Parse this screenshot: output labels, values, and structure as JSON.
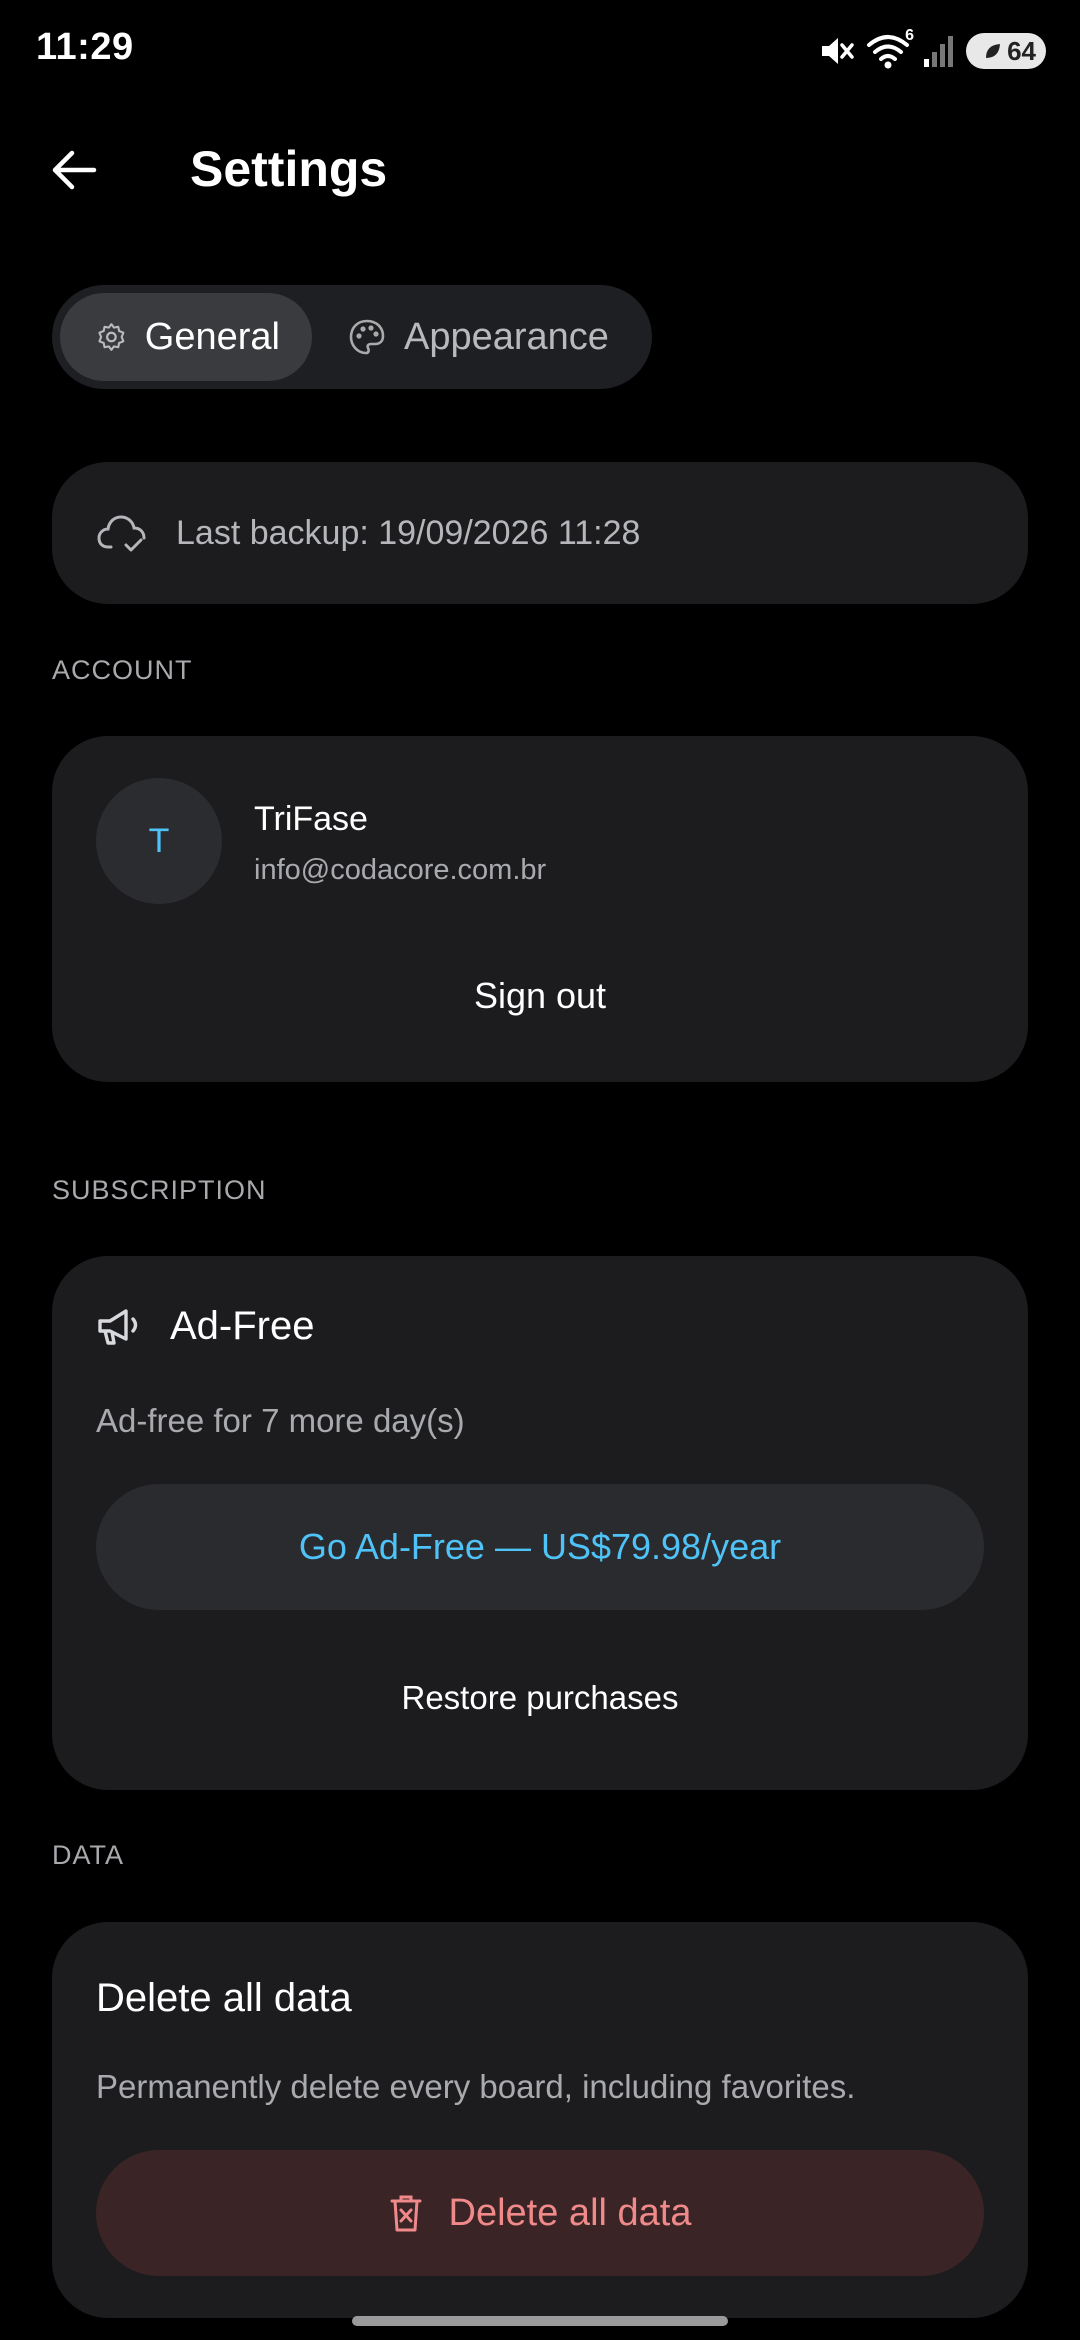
{
  "status_bar": {
    "time": "11:29",
    "wifi_badge": "6",
    "battery": "64"
  },
  "header": {
    "title": "Settings"
  },
  "tabs": [
    {
      "label": "General",
      "icon": "gear-icon",
      "active": true
    },
    {
      "label": "Appearance",
      "icon": "palette-icon",
      "active": false
    }
  ],
  "backup": {
    "icon": "cloud-check-icon",
    "text": "Last backup: 19/09/2026 11:28"
  },
  "account": {
    "section_label": "ACCOUNT",
    "avatar_initial": "T",
    "name": "TriFase",
    "email": "info@codacore.com.br",
    "sign_out": "Sign out"
  },
  "subscription": {
    "section_label": "SUBSCRIPTION",
    "icon": "megaphone-icon",
    "title": "Ad-Free",
    "description": "Ad-free for 7 more day(s)",
    "cta": "Go Ad-Free — US$79.98/year",
    "restore": "Restore purchases"
  },
  "data": {
    "section_label": "DATA",
    "title": "Delete all data",
    "description": "Permanently delete every board, including favorites.",
    "delete_button": "Delete all data",
    "delete_icon": "trash-icon"
  },
  "colors": {
    "accent": "#4fc3f7",
    "danger": "#f08a8a",
    "card": "#1c1c1e",
    "background": "#000000"
  }
}
